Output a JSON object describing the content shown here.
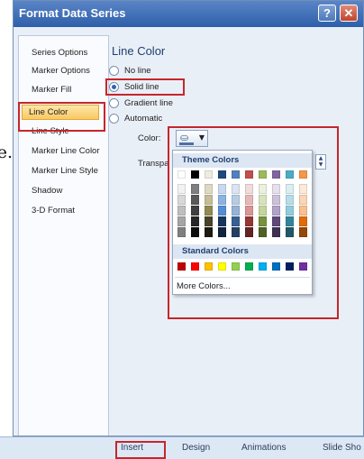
{
  "fragment_text": "e.",
  "window": {
    "title": "Format Data Series",
    "help_glyph": "?",
    "close_glyph": "✕"
  },
  "nav": {
    "items": [
      {
        "label": "Series Options"
      },
      {
        "label": "Marker Options"
      },
      {
        "label": "Marker Fill"
      },
      {
        "label": "Line Color",
        "selected": true
      },
      {
        "label": "Line Style"
      },
      {
        "label": "Marker Line Color"
      },
      {
        "label": "Marker Line Style"
      },
      {
        "label": "Shadow"
      },
      {
        "label": "3-D Format"
      }
    ]
  },
  "pane": {
    "title": "Line Color",
    "options": [
      {
        "label": "No line",
        "checked": false
      },
      {
        "label": "Solid line",
        "checked": true
      },
      {
        "label": "Gradient line",
        "checked": false
      },
      {
        "label": "Automatic",
        "checked": false
      }
    ],
    "color_label": "Color:",
    "transparency_label": "Transpa"
  },
  "color_picker": {
    "theme_header": "Theme Colors",
    "theme_top_row": [
      "#ffffff",
      "#000000",
      "#eeece1",
      "#1f497d",
      "#4f81bd",
      "#c0504d",
      "#9bbb59",
      "#8064a2",
      "#4bacc6",
      "#f79646"
    ],
    "theme_shades": [
      [
        "#f2f2f2",
        "#7f7f7f",
        "#ddd9c3",
        "#c6d9f0",
        "#dbe5f1",
        "#f2dcdb",
        "#ebf1dd",
        "#e5e0ec",
        "#dbeef3",
        "#fdeada"
      ],
      [
        "#d8d8d8",
        "#595959",
        "#c4bd97",
        "#8db3e2",
        "#b8cce4",
        "#e5b9b7",
        "#d7e3bc",
        "#ccc1d9",
        "#b7dde8",
        "#fbd5b5"
      ],
      [
        "#bfbfbf",
        "#3f3f3f",
        "#938953",
        "#548dd4",
        "#95b3d7",
        "#d99694",
        "#c3d69b",
        "#b2a2c7",
        "#92cddc",
        "#fac08f"
      ],
      [
        "#a5a5a5",
        "#262626",
        "#494429",
        "#17365d",
        "#366092",
        "#953734",
        "#76923c",
        "#5f497a",
        "#31859b",
        "#e36c09"
      ],
      [
        "#7f7f7f",
        "#0c0c0c",
        "#1d1b10",
        "#0f243e",
        "#244061",
        "#632423",
        "#4f6128",
        "#3f3151",
        "#205867",
        "#974806"
      ]
    ],
    "standard_header": "Standard Colors",
    "standard_colors": [
      "#c00000",
      "#ff0000",
      "#ffc000",
      "#ffff00",
      "#92d050",
      "#00b050",
      "#00b0f0",
      "#0070c0",
      "#002060",
      "#7030a0"
    ],
    "more_label": "More Colors..."
  },
  "ribbon_tabs": [
    {
      "label": "Insert"
    },
    {
      "label": "Design"
    },
    {
      "label": "Animations"
    },
    {
      "label": "Slide Sho"
    }
  ],
  "accent_colors": {
    "highlight_box": "#c6262b",
    "selection": "#f9c863",
    "titlebar": "#2e5fa9"
  }
}
